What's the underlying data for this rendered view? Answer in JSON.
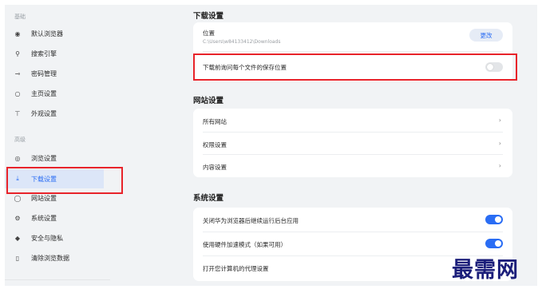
{
  "sidebar": {
    "group_basic": "基础",
    "group_advanced": "高级",
    "items": [
      {
        "label": "默认浏览器",
        "icon": "default-browser-icon",
        "glyph": "◉"
      },
      {
        "label": "搜索引擎",
        "icon": "search-icon",
        "glyph": "⚲"
      },
      {
        "label": "密码管理",
        "icon": "key-icon",
        "glyph": "⊸"
      },
      {
        "label": "主页设置",
        "icon": "home-icon",
        "glyph": "○"
      },
      {
        "label": "外观设置",
        "icon": "appearance-icon",
        "glyph": "⊤"
      },
      {
        "label": "浏览设置",
        "icon": "eye-icon",
        "glyph": "◎"
      },
      {
        "label": "下载设置",
        "icon": "download-icon",
        "glyph": "⤓"
      },
      {
        "label": "网站设置",
        "icon": "website-icon",
        "glyph": "◯"
      },
      {
        "label": "系统设置",
        "icon": "system-icon",
        "glyph": "⚙"
      },
      {
        "label": "安全与隐私",
        "icon": "shield-icon",
        "glyph": "◆"
      },
      {
        "label": "清除浏览数据",
        "icon": "trash-icon",
        "glyph": "▯"
      }
    ],
    "active_index": 6
  },
  "download": {
    "title": "下载设置",
    "location_label": "位置",
    "location_path": "C:\\Users\\w84133412\\Downloads",
    "change_button": "更改",
    "ask_label": "下载前询问每个文件的保存位置",
    "ask_enabled": false
  },
  "website": {
    "title": "网站设置",
    "items": [
      "所有网站",
      "权限设置",
      "内容设置"
    ]
  },
  "system": {
    "title": "系统设置",
    "items": [
      {
        "label": "关闭华为浏览器后继续运行后台应用",
        "enabled": true
      },
      {
        "label": "使用硬件加速模式（如果可用）",
        "enabled": true
      },
      {
        "label": "打开您计算机的代理设置"
      }
    ]
  },
  "watermark": "最需网",
  "colors": {
    "accent": "#2a6df4",
    "highlight_box": "#e8232a",
    "background": "#f1f3f5"
  }
}
